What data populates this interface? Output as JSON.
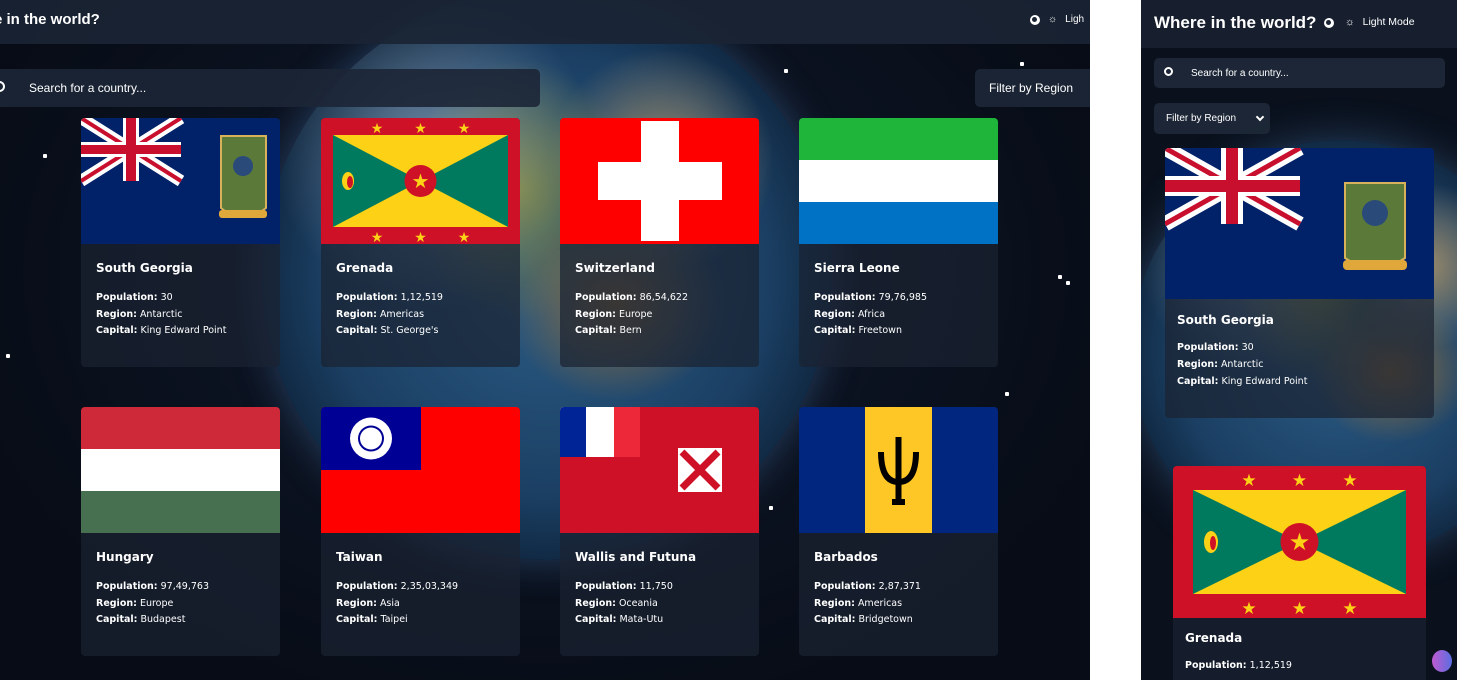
{
  "desktop": {
    "header": {
      "title": "e in the world?",
      "mode_label": "Ligh"
    },
    "search": {
      "placeholder": "Search for a country..."
    },
    "filter_label": "Filter by Region",
    "labels": {
      "population": "Population:",
      "region": "Region:",
      "capital": "Capital:"
    },
    "countries": [
      {
        "name": "South Georgia",
        "population": "30",
        "region": "Antarctic",
        "capital": "King Edward Point"
      },
      {
        "name": "Grenada",
        "population": "1,12,519",
        "region": "Americas",
        "capital": "St. George's"
      },
      {
        "name": "Switzerland",
        "population": "86,54,622",
        "region": "Europe",
        "capital": "Bern"
      },
      {
        "name": "Sierra Leone",
        "population": "79,76,985",
        "region": "Africa",
        "capital": "Freetown"
      },
      {
        "name": "Hungary",
        "population": "97,49,763",
        "region": "Europe",
        "capital": "Budapest"
      },
      {
        "name": "Taiwan",
        "population": "2,35,03,349",
        "region": "Asia",
        "capital": "Taipei"
      },
      {
        "name": "Wallis and Futuna",
        "population": "11,750",
        "region": "Oceania",
        "capital": "Mata-Utu"
      },
      {
        "name": "Barbados",
        "population": "2,87,371",
        "region": "Americas",
        "capital": "Bridgetown"
      }
    ]
  },
  "mobile": {
    "header": {
      "title": "Where in the world?",
      "mode_label": "Light Mode"
    },
    "search": {
      "placeholder": "Search for a country..."
    },
    "filter_label": "Filter by Region",
    "countries": [
      {
        "name": "South Georgia",
        "population": "30",
        "region": "Antarctic",
        "capital": "King Edward Point"
      },
      {
        "name": "Grenada",
        "population": "1,12,519"
      }
    ]
  },
  "icons": [
    "globe-icon",
    "sun-icon",
    "search-icon",
    "chevron-down-icon",
    "brain-icon"
  ],
  "colors": {
    "background": "#0b1220",
    "card": "#1a2232",
    "text": "#ffffff"
  }
}
